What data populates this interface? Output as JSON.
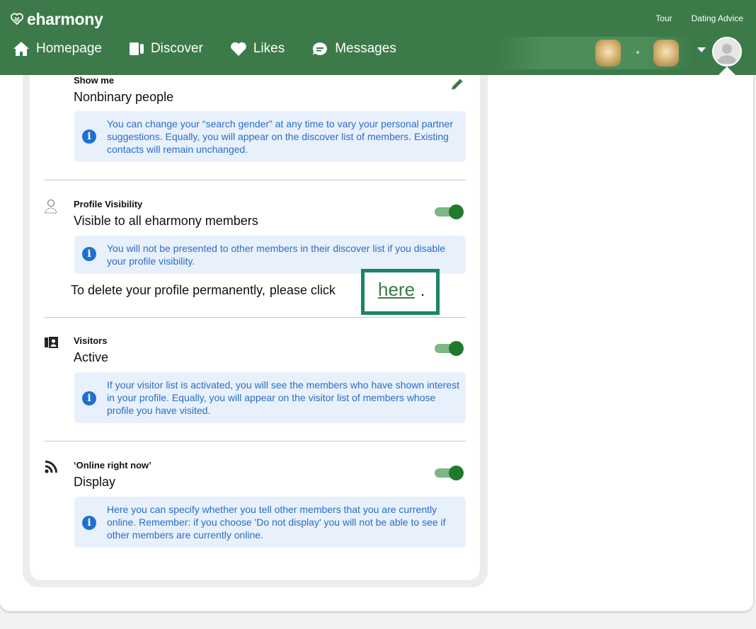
{
  "brand": {
    "name": "eharmony"
  },
  "top_links": [
    "Tour",
    "Dating Advice"
  ],
  "nav": {
    "items": [
      {
        "label": "Homepage",
        "icon": "home-icon"
      },
      {
        "label": "Discover",
        "icon": "discover-cards-icon"
      },
      {
        "label": "Likes",
        "icon": "heart-icon"
      },
      {
        "label": "Messages",
        "icon": "chat-bubble-icon"
      }
    ]
  },
  "settings": {
    "show_me": {
      "title": "Show me",
      "value": "Nonbinary people",
      "info": "You can change your “search gender” at any time to vary your personal partner suggestions. Equally, you will appear on the discover list of members. Existing contacts will remain unchanged."
    },
    "profile_visibility": {
      "title": "Profile Visibility",
      "value": "Visible to all eharmony members",
      "enabled": true,
      "info": "You will not be presented to other members in their discover list if you disable your profile visibility.",
      "delete_prefix": "To delete your profile permanently,",
      "delete_middle": "please click",
      "delete_link": "here",
      "delete_suffix": "."
    },
    "visitors": {
      "title": "Visitors",
      "value": "Active",
      "enabled": true,
      "info": "If your visitor list is activated, you will see the members who have shown interest in your profile. Equally, you will appear on the visitor list of members whose profile you have visited."
    },
    "online_now": {
      "title": "‘Online right now’",
      "value": "Display",
      "enabled": true,
      "info": "Here you can specify whether you tell other members that you are currently online. Remember: if you choose 'Do not display' you will not be able to see if other members are currently online."
    }
  },
  "colors": {
    "header_green": "#3c7a4a",
    "toggle_on": "#1f7a2c",
    "info_bg": "#e8f1fb",
    "info_text": "#2b6cc4",
    "highlight_border": "#1b8468"
  }
}
